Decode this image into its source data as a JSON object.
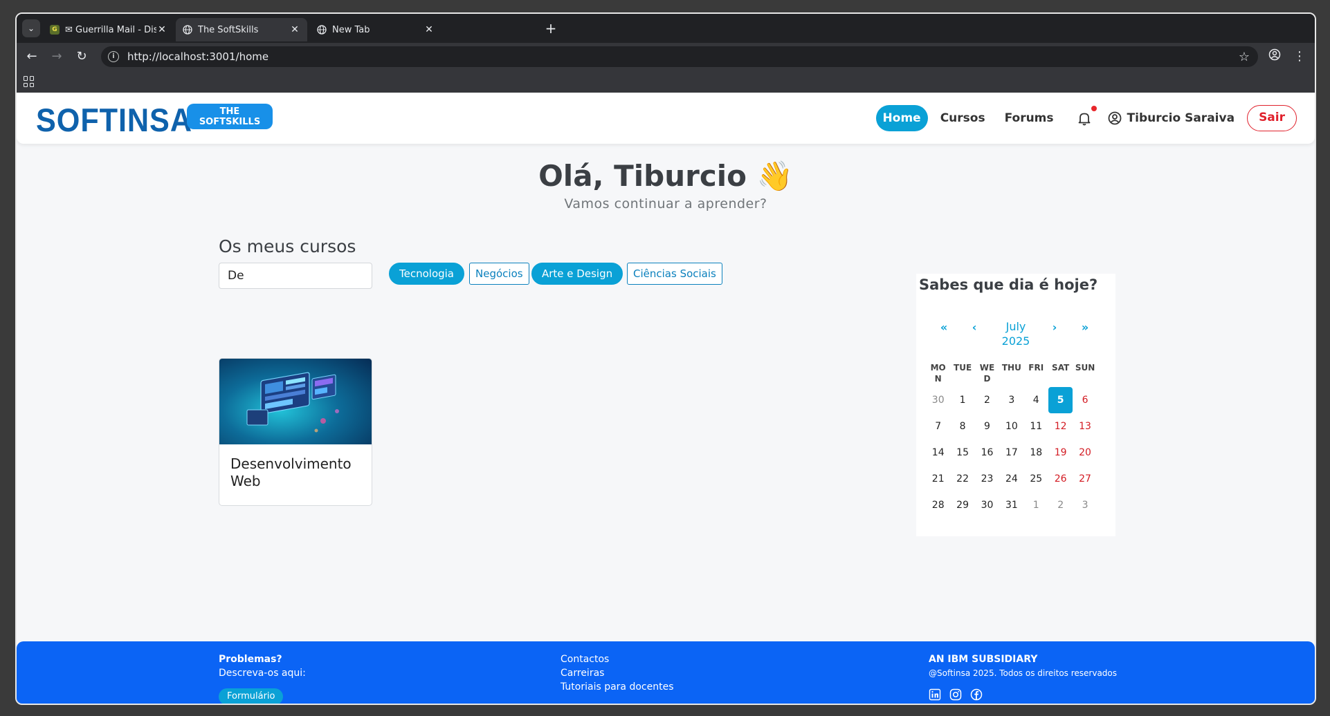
{
  "browser": {
    "tabs": [
      {
        "title": "✉ Guerrilla Mail - Disposa",
        "favicon": "G"
      },
      {
        "title": "The SoftSkills"
      },
      {
        "title": "New Tab"
      }
    ],
    "url": "http://localhost:3001/home"
  },
  "header": {
    "logo_text": "SOFTINSA",
    "logo_badge_line1": "THE",
    "logo_badge_line2": "SOFTSKILLS",
    "nav": [
      "Home",
      "Cursos",
      "Forums"
    ],
    "user_name": "Tiburcio Saraiva",
    "logout_label": "Sair"
  },
  "main": {
    "greeting": "Olá, Tiburcio 👋",
    "subtitle": "Vamos continuar a aprender?",
    "courses_title": "Os meus cursos",
    "search_value": "De",
    "categories": [
      "Tecnologia",
      "Negócios",
      "Arte e Design",
      "Ciências Sociais"
    ],
    "courses": [
      {
        "title": "Desenvolvimento Web"
      }
    ]
  },
  "calendar": {
    "title": "Sabes que dia é hoje?",
    "nav": {
      "prev_year": "«",
      "prev_month": "‹",
      "next_month": "›",
      "next_year": "»"
    },
    "month_label": "July",
    "year_label": "2025",
    "weekdays": [
      "MON",
      "TUE",
      "WED",
      "THU",
      "FRI",
      "SAT",
      "SUN"
    ],
    "weeks": [
      [
        "30",
        "1",
        "2",
        "3",
        "4",
        "5",
        "6"
      ],
      [
        "7",
        "8",
        "9",
        "10",
        "11",
        "12",
        "13"
      ],
      [
        "14",
        "15",
        "16",
        "17",
        "18",
        "19",
        "20"
      ],
      [
        "21",
        "22",
        "23",
        "24",
        "25",
        "26",
        "27"
      ],
      [
        "28",
        "29",
        "30",
        "31",
        "1",
        "2",
        "3"
      ]
    ],
    "today": "5"
  },
  "footer": {
    "problems_title": "Problemas?",
    "problems_text": "Descreva-os aqui:",
    "form_button": "Formulário",
    "links": [
      "Contactos",
      "Carreiras",
      "Tutoriais para docentes"
    ],
    "company_title": "AN IBM SUBSIDIARY",
    "copyright": "@Softinsa 2025. Todos os direitos reservados",
    "socials": [
      "linkedin-icon",
      "instagram-icon",
      "facebook-icon"
    ]
  },
  "colors": {
    "accent": "#0aa1d6",
    "brand": "#0f62ac",
    "footer": "#0b64f5",
    "danger": "#e0212c"
  }
}
